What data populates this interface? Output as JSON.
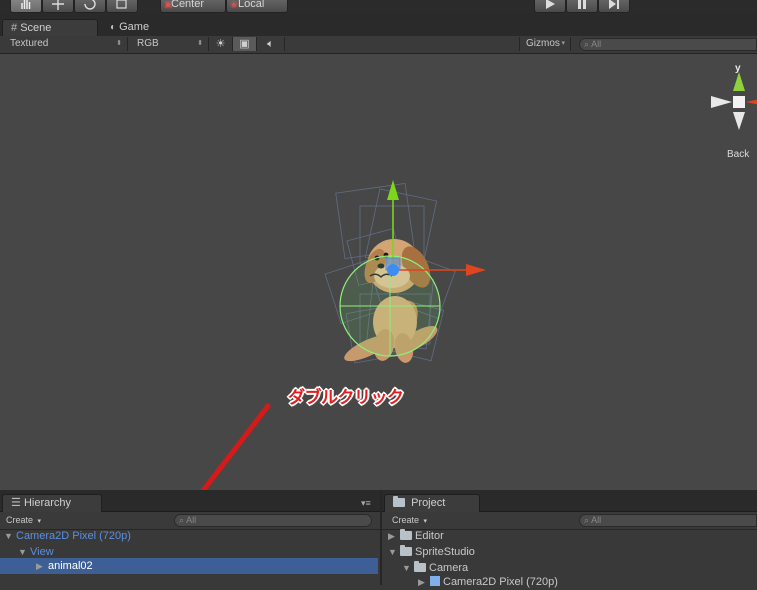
{
  "toolbar": {
    "pivot_label": "Center",
    "space_label": "Local"
  },
  "scene_tabs": [
    {
      "label": "Scene"
    },
    {
      "label": "Game"
    }
  ],
  "scene_controls": {
    "render_mode": "Textured",
    "color_mode": "RGB",
    "gizmos_label": "Gizmos",
    "search_placeholder": "All"
  },
  "orientation_gizmo": {
    "axis_label": "y",
    "view_label": "Back"
  },
  "annotation": {
    "text": "ダブルクリック",
    "color": "#e02020"
  },
  "hierarchy": {
    "tab_label": "Hierarchy",
    "create_label": "Create",
    "search_placeholder": "All",
    "items": [
      {
        "label": "Camera2D Pixel (720p)"
      },
      {
        "label": "View"
      },
      {
        "label": "animal02",
        "selected": true
      }
    ]
  },
  "project": {
    "tab_label": "Project",
    "create_label": "Create",
    "search_placeholder": "All",
    "items": [
      {
        "label": "Editor"
      },
      {
        "label": "SpriteStudio"
      },
      {
        "label": "Camera"
      },
      {
        "label": "Camera2D Pixel (720p)"
      }
    ]
  },
  "colors": {
    "selection": "#3e5f96",
    "hierarchy_link": "#5a8fe0",
    "x_axis": "#e0451d",
    "y_axis": "#7bd61c",
    "gizmo_circle": "#8df07a"
  }
}
